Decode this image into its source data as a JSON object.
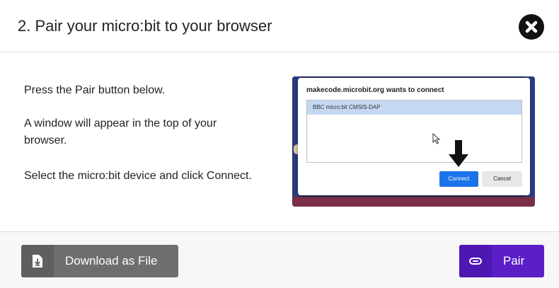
{
  "dialog": {
    "title": "2. Pair your micro:bit to your browser",
    "close_icon": "close-icon"
  },
  "instructions": [
    "Press the Pair button below.",
    "A window will appear in the top of your browser.",
    "Select the micro:bit device and click Connect."
  ],
  "illustration": {
    "title": "makecode.microbit.org wants to connect",
    "device": "BBC micro:bit CMSIS-DAP",
    "connect_label": "Connect",
    "cancel_label": "Cancel",
    "cursor_icon": "cursor-icon",
    "arrow_icon": "arrow-down-icon"
  },
  "footer": {
    "download_label": "Download as File",
    "download_icon": "file-download-icon",
    "pair_label": "Pair",
    "pair_icon": "link-icon"
  },
  "colors": {
    "pair_button": "#5b1fc7",
    "download_button": "#6e6e6e",
    "connect_button": "#1a73e8",
    "selected_device": "#c4d8f3"
  }
}
